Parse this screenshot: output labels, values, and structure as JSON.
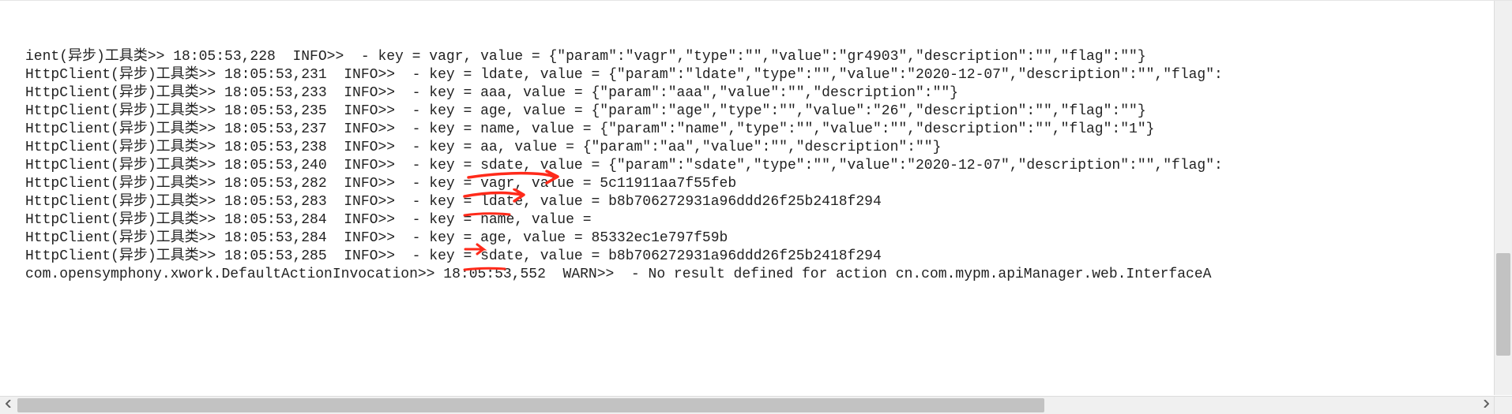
{
  "log": {
    "lines": [
      "ient(异步)工具类>> 18:05:53,228  INFO>>  - key = vagr, value = {\"param\":\"vagr\",\"type\":\"\",\"value\":\"gr4903\",\"description\":\"\",\"flag\":\"\"}",
      "HttpClient(异步)工具类>> 18:05:53,231  INFO>>  - key = ldate, value = {\"param\":\"ldate\",\"type\":\"\",\"value\":\"2020-12-07\",\"description\":\"\",\"flag\":",
      "HttpClient(异步)工具类>> 18:05:53,233  INFO>>  - key = aaa, value = {\"param\":\"aaa\",\"value\":\"\",\"description\":\"\"}",
      "HttpClient(异步)工具类>> 18:05:53,235  INFO>>  - key = age, value = {\"param\":\"age\",\"type\":\"\",\"value\":\"26\",\"description\":\"\",\"flag\":\"\"}",
      "HttpClient(异步)工具类>> 18:05:53,237  INFO>>  - key = name, value = {\"param\":\"name\",\"type\":\"\",\"value\":\"\",\"description\":\"\",\"flag\":\"1\"}",
      "HttpClient(异步)工具类>> 18:05:53,238  INFO>>  - key = aa, value = {\"param\":\"aa\",\"value\":\"\",\"description\":\"\"}",
      "HttpClient(异步)工具类>> 18:05:53,240  INFO>>  - key = sdate, value = {\"param\":\"sdate\",\"type\":\"\",\"value\":\"2020-12-07\",\"description\":\"\",\"flag\":",
      "HttpClient(异步)工具类>> 18:05:53,282  INFO>>  - key = vagr, value = 5c11911aa7f55feb",
      "HttpClient(异步)工具类>> 18:05:53,283  INFO>>  - key = ldate, value = b8b706272931a96ddd26f25b2418f294",
      "HttpClient(异步)工具类>> 18:05:53,284  INFO>>  - key = name, value = ",
      "HttpClient(异步)工具类>> 18:05:53,284  INFO>>  - key = age, value = 85332ec1e797f59b",
      "HttpClient(异步)工具类>> 18:05:53,285  INFO>>  - key = sdate, value = b8b706272931a96ddd26f25b2418f294",
      "com.opensymphony.xwork.DefaultActionInvocation>> 18:05:53,552  WARN>>  - No result defined for action cn.com.mypm.apiManager.web.InterfaceA"
    ]
  },
  "annotations": {
    "color": "#ff2a1a"
  }
}
